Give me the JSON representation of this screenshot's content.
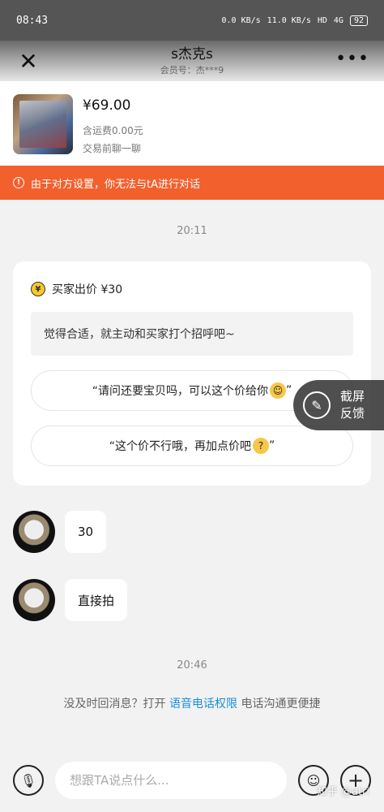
{
  "status_bar": {
    "time": "08:43",
    "net_speed_1": "0.0 KB/s",
    "net_speed_2": "11.0 KB/s",
    "hd": "HD",
    "signal": "4G",
    "battery": "92"
  },
  "nav": {
    "title": "s杰克s",
    "subtitle": "会员号：杰***9"
  },
  "product": {
    "price": "¥69.00",
    "shipping": "含运费0.00元",
    "trade_status": "交易前聊一聊"
  },
  "warning": {
    "text": "由于对方设置，你无法与tA进行对话"
  },
  "timestamps": {
    "first": "20:11",
    "second": "20:46"
  },
  "offer": {
    "title": "买家出价 ¥30",
    "hint": "觉得合适，就主动和买家打个招呼吧~",
    "quick_reply_1": "“请问还要宝贝吗，可以这个价给你",
    "quick_reply_1_end": "”",
    "quick_reply_2": "“这个价不行哦，再加点价吧",
    "quick_reply_2_end": "”"
  },
  "feedback": {
    "line1": "截屏",
    "line2": "反馈"
  },
  "messages": [
    {
      "text": "30"
    },
    {
      "text": "直接拍"
    }
  ],
  "voice_tip": {
    "before": "没及时回消息？打开 ",
    "link": "语音电话权限",
    "after": " 电话沟通更便捷"
  },
  "input": {
    "placeholder": "想跟TA说点什么..."
  },
  "watermark": "知乎 @atri"
}
